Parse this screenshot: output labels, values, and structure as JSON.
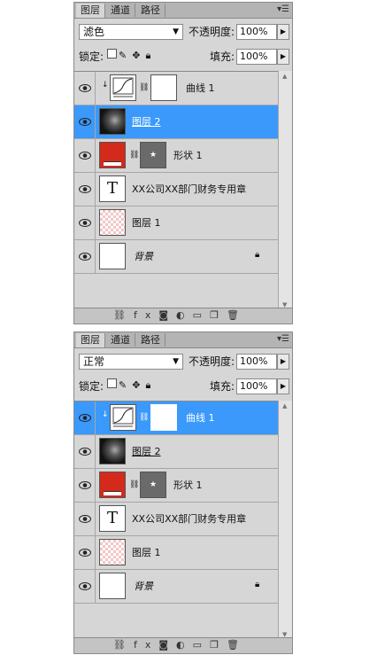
{
  "panels": [
    {
      "tabs": [
        "图层",
        "通道",
        "路径"
      ],
      "blend_mode": "滤色",
      "opacity_label": "不透明度:",
      "opacity": "100%",
      "lock_label": "锁定:",
      "fill_label": "填充:",
      "fill": "100%",
      "layers": [
        {
          "name": "曲线 1",
          "type": "curves",
          "selected": false
        },
        {
          "name": "图层 2",
          "type": "image",
          "selected": true
        },
        {
          "name": "形状 1",
          "type": "shape",
          "selected": false
        },
        {
          "name": "XX公司XX部门财务专用章",
          "type": "text",
          "selected": false
        },
        {
          "name": "图层 1",
          "type": "transparent",
          "selected": false
        },
        {
          "name": "背景",
          "type": "background",
          "selected": false
        }
      ]
    },
    {
      "tabs": [
        "图层",
        "通道",
        "路径"
      ],
      "blend_mode": "正常",
      "opacity_label": "不透明度:",
      "opacity": "100%",
      "lock_label": "锁定:",
      "fill_label": "填充:",
      "fill": "100%",
      "layers": [
        {
          "name": "曲线 1",
          "type": "curves",
          "selected": true
        },
        {
          "name": "图层 2",
          "type": "image",
          "selected": false
        },
        {
          "name": "形状 1",
          "type": "shape",
          "selected": false
        },
        {
          "name": "XX公司XX部门财务专用章",
          "type": "text",
          "selected": false
        },
        {
          "name": "图层 1",
          "type": "transparent",
          "selected": false
        },
        {
          "name": "背景",
          "type": "background",
          "selected": false
        }
      ]
    }
  ],
  "colors": {
    "selected": "#3b99fc",
    "shape_fill": "#d42a1c",
    "panel_bg": "#d6d6d6"
  },
  "footer_icons": [
    "link-icon",
    "fx-icon",
    "mask-icon",
    "adjustment-icon",
    "folder-icon",
    "new-layer-icon",
    "trash-icon"
  ]
}
